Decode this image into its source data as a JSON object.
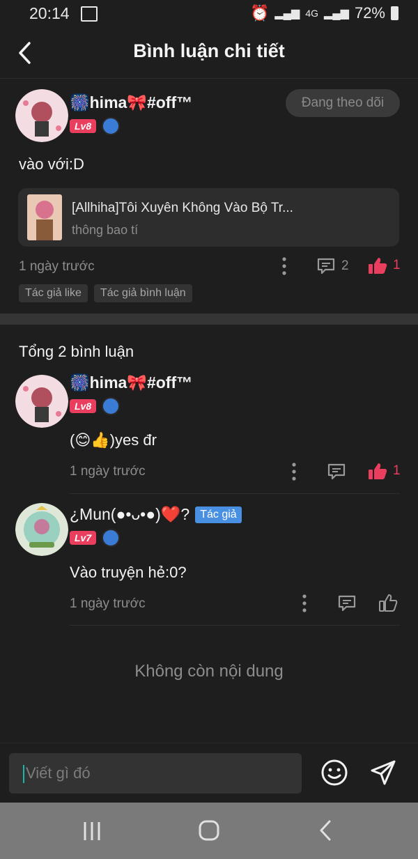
{
  "status": {
    "time": "20:14",
    "network": "4G",
    "battery": "72%"
  },
  "header": {
    "title": "Bình luận chi tiết"
  },
  "comment": {
    "username": "🎆hima🎀#off™",
    "level": "Lv8",
    "follow_label": "Đang theo dõi",
    "text": "vào với:D",
    "story": {
      "title": "[Allhiha]Tôi Xuyên Không Vào Bộ Tr...",
      "subtitle": "thông bao tí"
    },
    "time": "1 ngày trước",
    "reply_count": "2",
    "like_count": "1",
    "tags": [
      "Tác giả like",
      "Tác giả bình luận"
    ]
  },
  "replies_header": "Tổng 2 bình luận",
  "replies": [
    {
      "username": "🎆hima🎀#off™",
      "level": "Lv8",
      "text": "(😊👍)yes đr",
      "time": "1 ngày trước",
      "like_count": "1",
      "liked": true
    },
    {
      "username": "¿Mun(●•ᴗ•●)❤️?",
      "badge": "Tác giả",
      "level": "Lv7",
      "text": "Vào truyện hẻ:0?",
      "time": "1 ngày trước",
      "like_count": "",
      "liked": false
    }
  ],
  "end_text": "Không còn nội dung",
  "input": {
    "placeholder": "Viết gì đó"
  },
  "colors": {
    "accent": "#ea3e5f",
    "author_badge": "#4a90e2",
    "background": "#1e1e1e"
  }
}
